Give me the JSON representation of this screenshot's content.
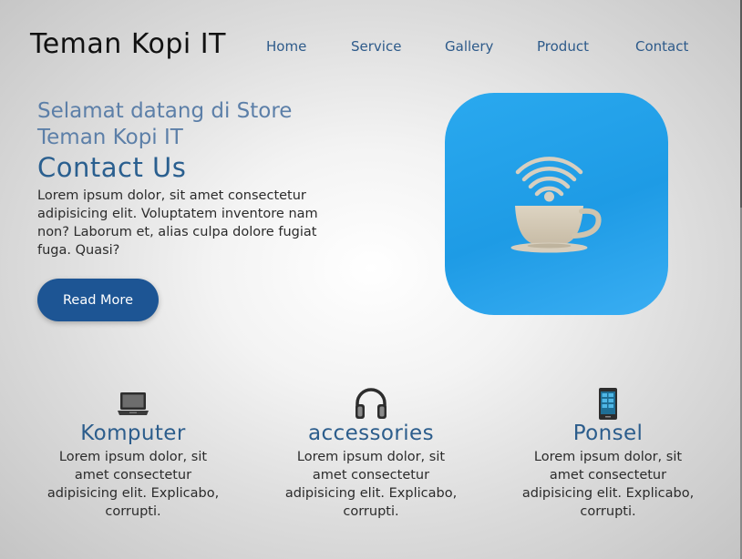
{
  "header": {
    "brand": "Teman Kopi IT",
    "nav": [
      {
        "label": "Home"
      },
      {
        "label": "Service"
      },
      {
        "label": "Gallery"
      },
      {
        "label": "Product"
      },
      {
        "label": "Contact"
      }
    ]
  },
  "hero": {
    "subtitle": "Selamat datang di Store Teman Kopi IT",
    "title": "Contact Us",
    "text": "Lorem ipsum dolor, sit amet consectetur adipisicing elit. Voluptatem inventore nam non? Laborum et, alias culpa dolore fugiat fuga. Quasi?",
    "button_label": "Read More",
    "image_icon": "coffee-cup-wifi-icon"
  },
  "features": [
    {
      "icon": "laptop-icon",
      "title": "Komputer",
      "text": "Lorem ipsum dolor, sit amet consectetur adipisicing elit. Explicabo, corrupti."
    },
    {
      "icon": "headphones-icon",
      "title": "accessories",
      "text": "Lorem ipsum dolor, sit amet consectetur adipisicing elit. Explicabo, corrupti."
    },
    {
      "icon": "smartphone-icon",
      "title": "Ponsel",
      "text": "Lorem ipsum dolor, sit amet consectetur adipisicing elit. Explicabo, corrupti."
    }
  ],
  "colors": {
    "accent": "#1d5594",
    "heading": "#2c5d8c",
    "hero_image_bg": "#1e9be5"
  }
}
